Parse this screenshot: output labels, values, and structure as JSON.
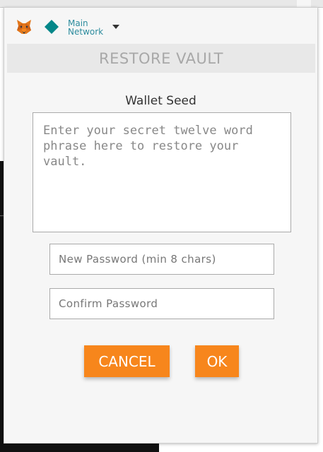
{
  "header": {
    "network_line1": "Main",
    "network_line2": "Network",
    "icons": [
      "fox-logo-icon",
      "network-diamond-icon",
      "chevron-down-icon"
    ],
    "network_color": "#2d8c9e"
  },
  "title": "RESTORE VAULT",
  "seed": {
    "label": "Wallet Seed",
    "placeholder": "Enter your secret twelve word phrase here to restore your vault.",
    "value": ""
  },
  "password": {
    "new_placeholder": "New Password (min 8 chars)",
    "confirm_placeholder": "Confirm Password"
  },
  "buttons": {
    "cancel_label": "CANCEL",
    "ok_label": "OK",
    "color": "#f7861c"
  }
}
